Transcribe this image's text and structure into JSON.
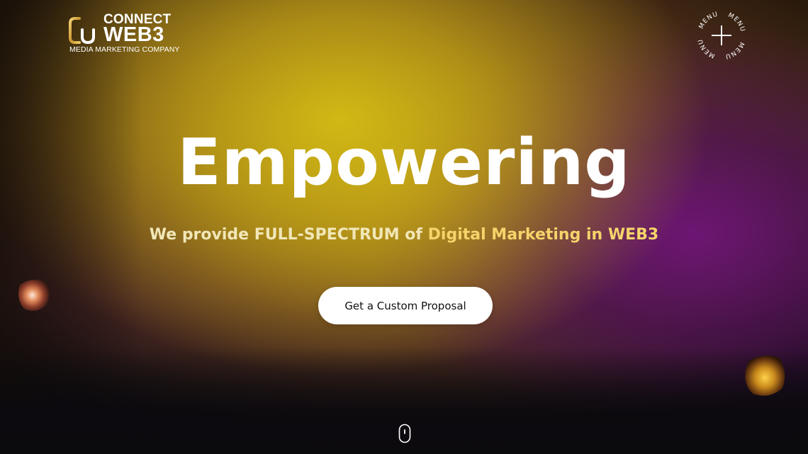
{
  "brand": {
    "connect": "CONNECT",
    "web3": "WEB3",
    "tagline": "MEDIA MARKETING COMPANY"
  },
  "menu": {
    "label": "MENU",
    "icon": "plus-icon"
  },
  "hero": {
    "title": "Empowering",
    "subtitle_part1": "We provide FULL-SPECTRUM of ",
    "subtitle_part2": "Digital Marketing in WEB3",
    "cta_label": "Get a Custom Proposal"
  },
  "colors": {
    "accent_yellow": "#d9bd1a",
    "accent_purple": "#6e1478",
    "highlight_text": "#f5d46b",
    "cta_bg": "#ffffff"
  },
  "icons": {
    "scroll": "mouse-scroll-icon"
  }
}
